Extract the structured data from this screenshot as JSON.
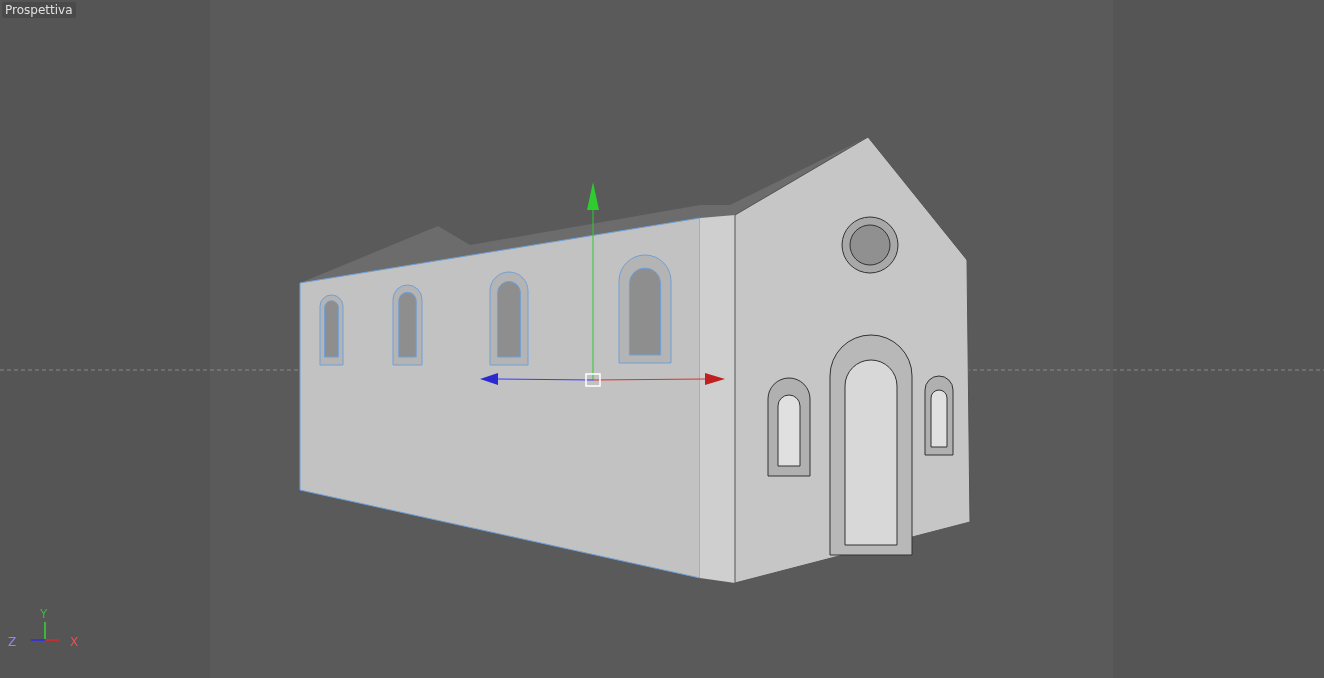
{
  "viewport": {
    "label": "Prospettiva"
  },
  "axis_indicator": {
    "y_label": "Y",
    "z_label": "Z",
    "x_label": "X"
  }
}
